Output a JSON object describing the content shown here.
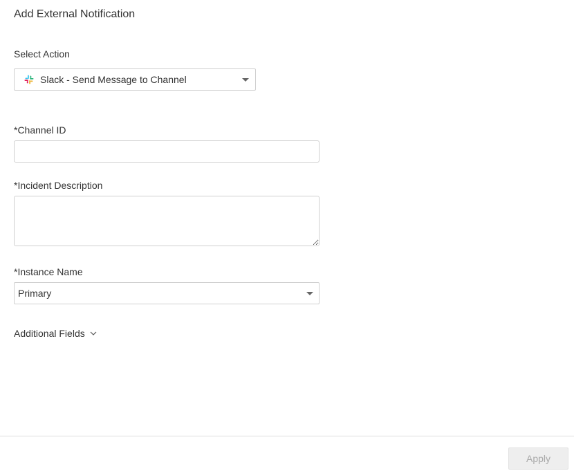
{
  "header": {
    "title": "Add External Notification"
  },
  "action": {
    "label": "Select Action",
    "selected": "Slack - Send Message to Channel",
    "icon": "slack-icon"
  },
  "channel_id": {
    "label": "*Channel ID",
    "value": "",
    "placeholder": ""
  },
  "incident_description": {
    "label": "*Incident Description",
    "value": "",
    "placeholder": ""
  },
  "instance_name": {
    "label": "*Instance Name",
    "selected": "Primary"
  },
  "additional_fields": {
    "label": "Additional Fields",
    "icon": "chevron-down-icon"
  },
  "footer": {
    "apply_label": "Apply"
  },
  "colors": {
    "text": "#333333",
    "border": "#cfcfcf",
    "apply_disabled_bg": "#eeeeee",
    "apply_disabled_text": "#a9a9a9",
    "slack_blue": "#36C5F0",
    "slack_green": "#2EB67D",
    "slack_yellow": "#ECB22E",
    "slack_red": "#E01E5A"
  }
}
